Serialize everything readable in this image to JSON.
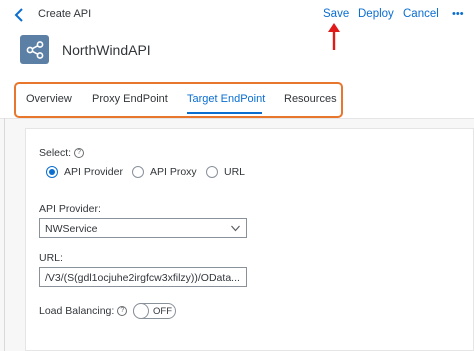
{
  "header": {
    "title": "Create API",
    "actions": {
      "save": "Save",
      "deploy": "Deploy",
      "cancel": "Cancel",
      "more": "•••"
    }
  },
  "api": {
    "name": "NorthWindAPI"
  },
  "tabs": [
    {
      "label": "Overview",
      "active": false
    },
    {
      "label": "Proxy EndPoint",
      "active": false
    },
    {
      "label": "Target EndPoint",
      "active": true
    },
    {
      "label": "Resources",
      "active": false
    }
  ],
  "form": {
    "select_label": "Select:",
    "options": [
      {
        "label": "API Provider",
        "checked": true
      },
      {
        "label": "API Proxy",
        "checked": false
      },
      {
        "label": "URL",
        "checked": false
      }
    ],
    "provider_label": "API Provider:",
    "provider_value": "NWService",
    "url_label": "URL:",
    "url_value": "/V3/(S(gdl1ocjuhe2irgfcw3xfilzy))/OData...",
    "lb_label": "Load Balancing:",
    "lb_state": "OFF"
  },
  "colors": {
    "accent": "#0a6ed1",
    "highlight": "#e8762d",
    "annotation_arrow": "#e01919",
    "api_icon_bg": "#5c7fa6"
  }
}
